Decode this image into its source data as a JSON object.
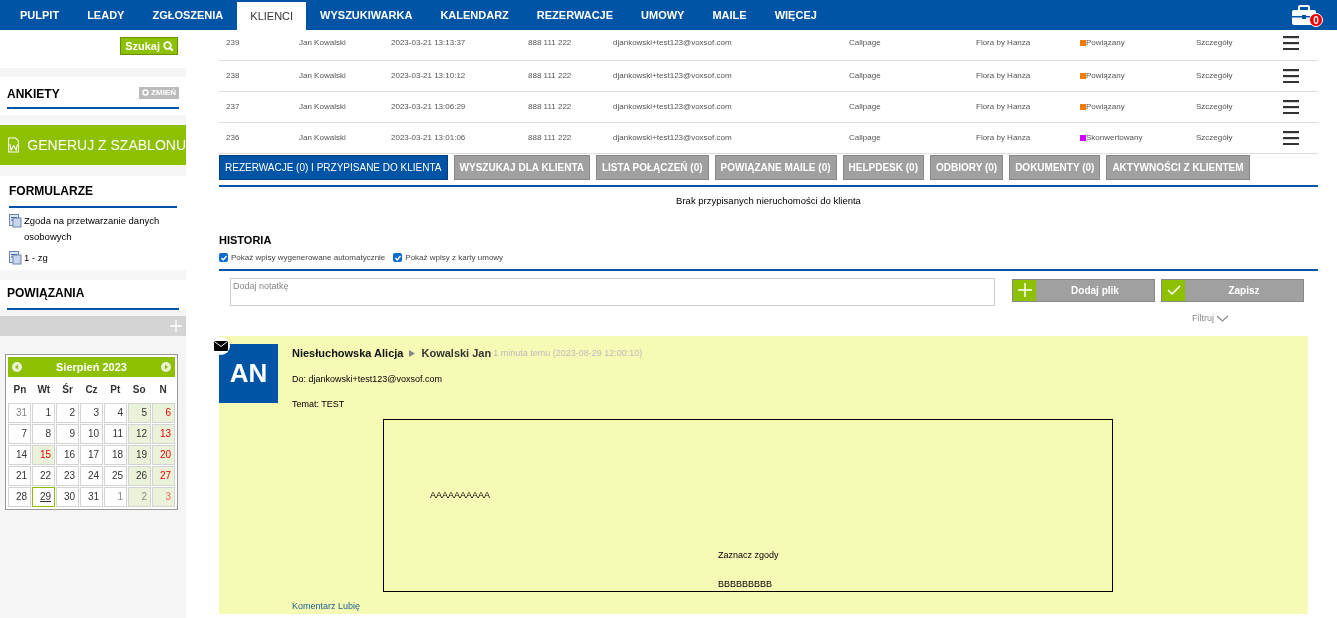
{
  "nav": {
    "tabs": [
      {
        "label": "PULPIT",
        "selected": false
      },
      {
        "label": "LEADY",
        "selected": false
      },
      {
        "label": "ZGŁOSZENIA",
        "selected": false
      },
      {
        "label": "KLIENCI",
        "selected": true
      },
      {
        "label": "WYSZUKIWARKA",
        "selected": false
      },
      {
        "label": "KALENDARZ",
        "selected": false
      },
      {
        "label": "REZERWACJE",
        "selected": false
      },
      {
        "label": "UMOWY",
        "selected": false
      },
      {
        "label": "MAILE",
        "selected": false
      },
      {
        "label": "WIĘCEJ",
        "selected": false
      }
    ],
    "badge": "0"
  },
  "sidebar": {
    "search_button": "Szukaj",
    "ankiety": {
      "title": "ANKIETY",
      "button": "ZMIEŃ"
    },
    "generate_button": "GENERUJ Z SZABLONU",
    "formularze": {
      "title": "FORMULARZE",
      "items": [
        "Zgoda na przetwarzanie danych osobowych",
        "1 - zg"
      ]
    },
    "powiazania": {
      "title": "POWIĄZANIA"
    },
    "calendar": {
      "month": "Sierpień 2023",
      "weekdays": [
        "Pn",
        "Wt",
        "Śr",
        "Cz",
        "Pt",
        "So",
        "N"
      ],
      "days": [
        {
          "day": "31",
          "muted": true,
          "shaded": false,
          "red": false,
          "selected": false
        },
        {
          "day": "1",
          "muted": false,
          "shaded": false,
          "red": false,
          "selected": false
        },
        {
          "day": "2",
          "muted": false,
          "shaded": false,
          "red": false,
          "selected": false
        },
        {
          "day": "3",
          "muted": false,
          "shaded": false,
          "red": false,
          "selected": false
        },
        {
          "day": "4",
          "muted": false,
          "shaded": false,
          "red": false,
          "selected": false
        },
        {
          "day": "5",
          "muted": false,
          "shaded": true,
          "red": false,
          "selected": false
        },
        {
          "day": "6",
          "muted": false,
          "shaded": true,
          "red": true,
          "selected": false
        },
        {
          "day": "7",
          "muted": false,
          "shaded": false,
          "red": false,
          "selected": false
        },
        {
          "day": "8",
          "muted": false,
          "shaded": false,
          "red": false,
          "selected": false
        },
        {
          "day": "9",
          "muted": false,
          "shaded": false,
          "red": false,
          "selected": false
        },
        {
          "day": "10",
          "muted": false,
          "shaded": false,
          "red": false,
          "selected": false
        },
        {
          "day": "11",
          "muted": false,
          "shaded": false,
          "red": false,
          "selected": false
        },
        {
          "day": "12",
          "muted": false,
          "shaded": true,
          "red": false,
          "selected": false
        },
        {
          "day": "13",
          "muted": false,
          "shaded": true,
          "red": true,
          "selected": false
        },
        {
          "day": "14",
          "muted": false,
          "shaded": false,
          "red": false,
          "selected": false
        },
        {
          "day": "15",
          "muted": false,
          "shaded": true,
          "red": true,
          "selected": false
        },
        {
          "day": "16",
          "muted": false,
          "shaded": false,
          "red": false,
          "selected": false
        },
        {
          "day": "17",
          "muted": false,
          "shaded": false,
          "red": false,
          "selected": false
        },
        {
          "day": "18",
          "muted": false,
          "shaded": false,
          "red": false,
          "selected": false
        },
        {
          "day": "19",
          "muted": false,
          "shaded": true,
          "red": false,
          "selected": false
        },
        {
          "day": "20",
          "muted": false,
          "shaded": true,
          "red": true,
          "selected": false
        },
        {
          "day": "21",
          "muted": false,
          "shaded": false,
          "red": false,
          "selected": false
        },
        {
          "day": "22",
          "muted": false,
          "shaded": false,
          "red": false,
          "selected": false
        },
        {
          "day": "23",
          "muted": false,
          "shaded": false,
          "red": false,
          "selected": false
        },
        {
          "day": "24",
          "muted": false,
          "shaded": false,
          "red": false,
          "selected": false
        },
        {
          "day": "25",
          "muted": false,
          "shaded": false,
          "red": false,
          "selected": false
        },
        {
          "day": "26",
          "muted": false,
          "shaded": true,
          "red": false,
          "selected": false
        },
        {
          "day": "27",
          "muted": false,
          "shaded": true,
          "red": true,
          "selected": false
        },
        {
          "day": "28",
          "muted": false,
          "shaded": false,
          "red": false,
          "selected": false
        },
        {
          "day": "29",
          "muted": false,
          "shaded": false,
          "red": false,
          "selected": true
        },
        {
          "day": "30",
          "muted": false,
          "shaded": false,
          "red": false,
          "selected": false
        },
        {
          "day": "31",
          "muted": false,
          "shaded": false,
          "red": false,
          "selected": false
        },
        {
          "day": "1",
          "muted": true,
          "shaded": false,
          "red": false,
          "selected": false
        },
        {
          "day": "2",
          "muted": true,
          "shaded": true,
          "red": false,
          "selected": false
        },
        {
          "day": "3",
          "muted": true,
          "shaded": true,
          "red": true,
          "selected": false
        }
      ]
    }
  },
  "table": {
    "rows": [
      {
        "id": "239",
        "name": "Jan Kowalski",
        "date": "2023-03-21 13:13:37",
        "phone": "888 111 222",
        "email": "djankowski+test123@voxsof.com",
        "source": "Callpage",
        "project": "Flora by Hanza",
        "status": "Powiązany",
        "color": "#f57c00",
        "details": "Szczegóły"
      },
      {
        "id": "238",
        "name": "Jan Kowalski",
        "date": "2023-03-21 13:10:12",
        "phone": "888 111 222",
        "email": "djankowski+test123@voxsof.com",
        "source": "Callpage",
        "project": "Flora by Hanza",
        "status": "Powiązany",
        "color": "#f57c00",
        "details": "Szczegóły"
      },
      {
        "id": "237",
        "name": "Jan Kowalski",
        "date": "2023-03-21 13:06:29",
        "phone": "888 111 222",
        "email": "djankowski+test123@voxsof.com",
        "source": "Callpage",
        "project": "Flora by Hanza",
        "status": "Powiązany",
        "color": "#f57c00",
        "details": "Szczegóły"
      },
      {
        "id": "236",
        "name": "Jan Kowalski",
        "date": "2023-03-21 13:01:06",
        "phone": "888 111 222",
        "email": "djankowski+test123@voxsof.com",
        "source": "Callpage",
        "project": "Flora by Hanza",
        "status": "Skonwertowany",
        "color": "#cc00ff",
        "details": "Szczegóły"
      }
    ]
  },
  "subtabs": [
    {
      "label": "REZERWACJE (0) I PRZYPISANE DO KLIENTA",
      "selected": true
    },
    {
      "label": "WYSZUKAJ DLA KLIENTA",
      "selected": false
    },
    {
      "label": "LISTA POŁĄCZEŃ (0)",
      "selected": false
    },
    {
      "label": "POWIĄZANE MAILE (0)",
      "selected": false
    },
    {
      "label": "HELPDESK (0)",
      "selected": false
    },
    {
      "label": "ODBIORY (0)",
      "selected": false
    },
    {
      "label": "DOKUMENTY (0)",
      "selected": false
    },
    {
      "label": "AKTYWNOŚCI Z KLIENTEM",
      "selected": false
    }
  ],
  "empty_message": "Brak przypisanych nieruchomości do klienta",
  "history": {
    "title": "HISTORIA",
    "filters": [
      {
        "label": "Pokaż wpisy wygenerowane automatycznie",
        "checked": true
      },
      {
        "label": "Pokaż wpisy z karty umowy",
        "checked": true
      }
    ],
    "note_placeholder": "Dodaj notatkę",
    "add_file": "Dodaj plik",
    "save": "Zapisz",
    "filter": "Filtruj",
    "entry": {
      "initials": "AN",
      "sender": "Niesłuchowska Alicja",
      "recipient": "Kowalski Jan",
      "time": "1 minuta temu (2023-08-29 12:00:10)",
      "to": "Do: djankowski+test123@voxsof.com",
      "subject": "Temat: TEST",
      "body": [
        "AAAAAAAAAA",
        "Zaznacz zgody",
        "BBBBBBBBB"
      ],
      "footer": "Komentarz Lubię"
    }
  }
}
